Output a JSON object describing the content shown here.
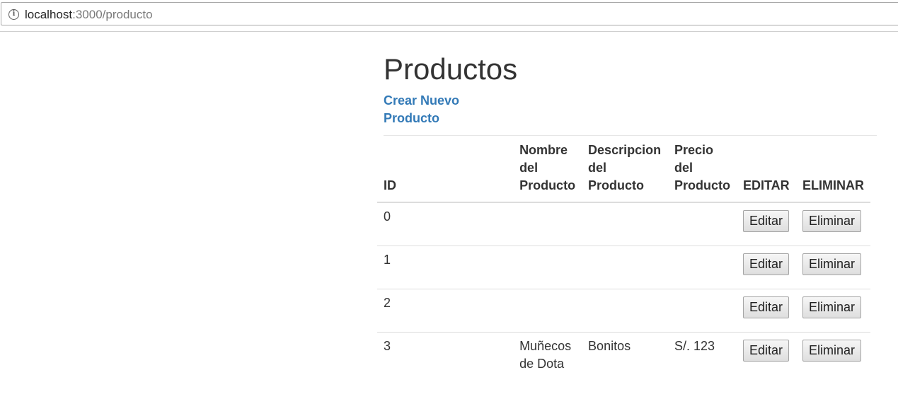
{
  "browser": {
    "url_host": "localhost",
    "url_path": ":3000/producto"
  },
  "page": {
    "title": "Productos",
    "new_link": "Crear Nuevo Producto"
  },
  "table": {
    "headers": {
      "id": "ID",
      "name": "Nombre del Producto",
      "description": "Descripcion del Producto",
      "price": "Precio del Producto",
      "edit": "EDITAR",
      "delete": "ELIMINAR"
    },
    "rows": [
      {
        "id": "0",
        "name": "",
        "description": "",
        "price": "",
        "edit_label": "Editar",
        "delete_label": "Eliminar"
      },
      {
        "id": "1",
        "name": "",
        "description": "",
        "price": "",
        "edit_label": "Editar",
        "delete_label": "Eliminar"
      },
      {
        "id": "2",
        "name": "",
        "description": "",
        "price": "",
        "edit_label": "Editar",
        "delete_label": "Eliminar"
      },
      {
        "id": "3",
        "name": "Muñecos de Dota",
        "description": "Bonitos",
        "price": "S/. 123",
        "edit_label": "Editar",
        "delete_label": "Eliminar"
      }
    ]
  },
  "colors": {
    "link": "#337ab7",
    "text": "#333333",
    "border": "#dddddd"
  }
}
